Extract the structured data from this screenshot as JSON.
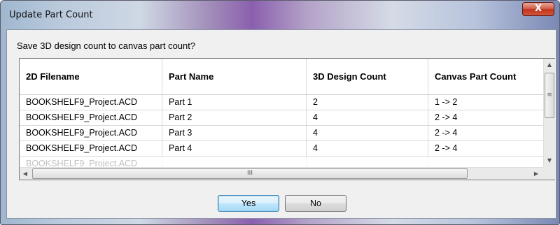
{
  "window": {
    "title": "Update Part Count",
    "close_symbol": "X"
  },
  "dialog": {
    "prompt": "Save 3D design count to canvas part count?"
  },
  "table": {
    "columns": [
      "2D Filename",
      "Part Name",
      "3D Design Count",
      "Canvas Part Count"
    ],
    "rows": [
      [
        "BOOKSHELF9_Project.ACD",
        "Part 1",
        "2",
        "1 -> 2"
      ],
      [
        "BOOKSHELF9_Project.ACD",
        "Part 2",
        "4",
        "2 -> 4"
      ],
      [
        "BOOKSHELF9_Project.ACD",
        "Part 3",
        "4",
        "2 -> 4"
      ],
      [
        "BOOKSHELF9_Project.ACD",
        "Part 4",
        "4",
        "2 -> 4"
      ]
    ]
  },
  "scrollbars": {
    "up": "▲",
    "down": "▼",
    "left": "◀",
    "right": "▶",
    "vgrip": "≡",
    "hgrip": "III"
  },
  "buttons": {
    "yes": "Yes",
    "no": "No"
  },
  "colors": {
    "default_button_border": "#3c7fb1",
    "close_button": "#c0351c"
  }
}
